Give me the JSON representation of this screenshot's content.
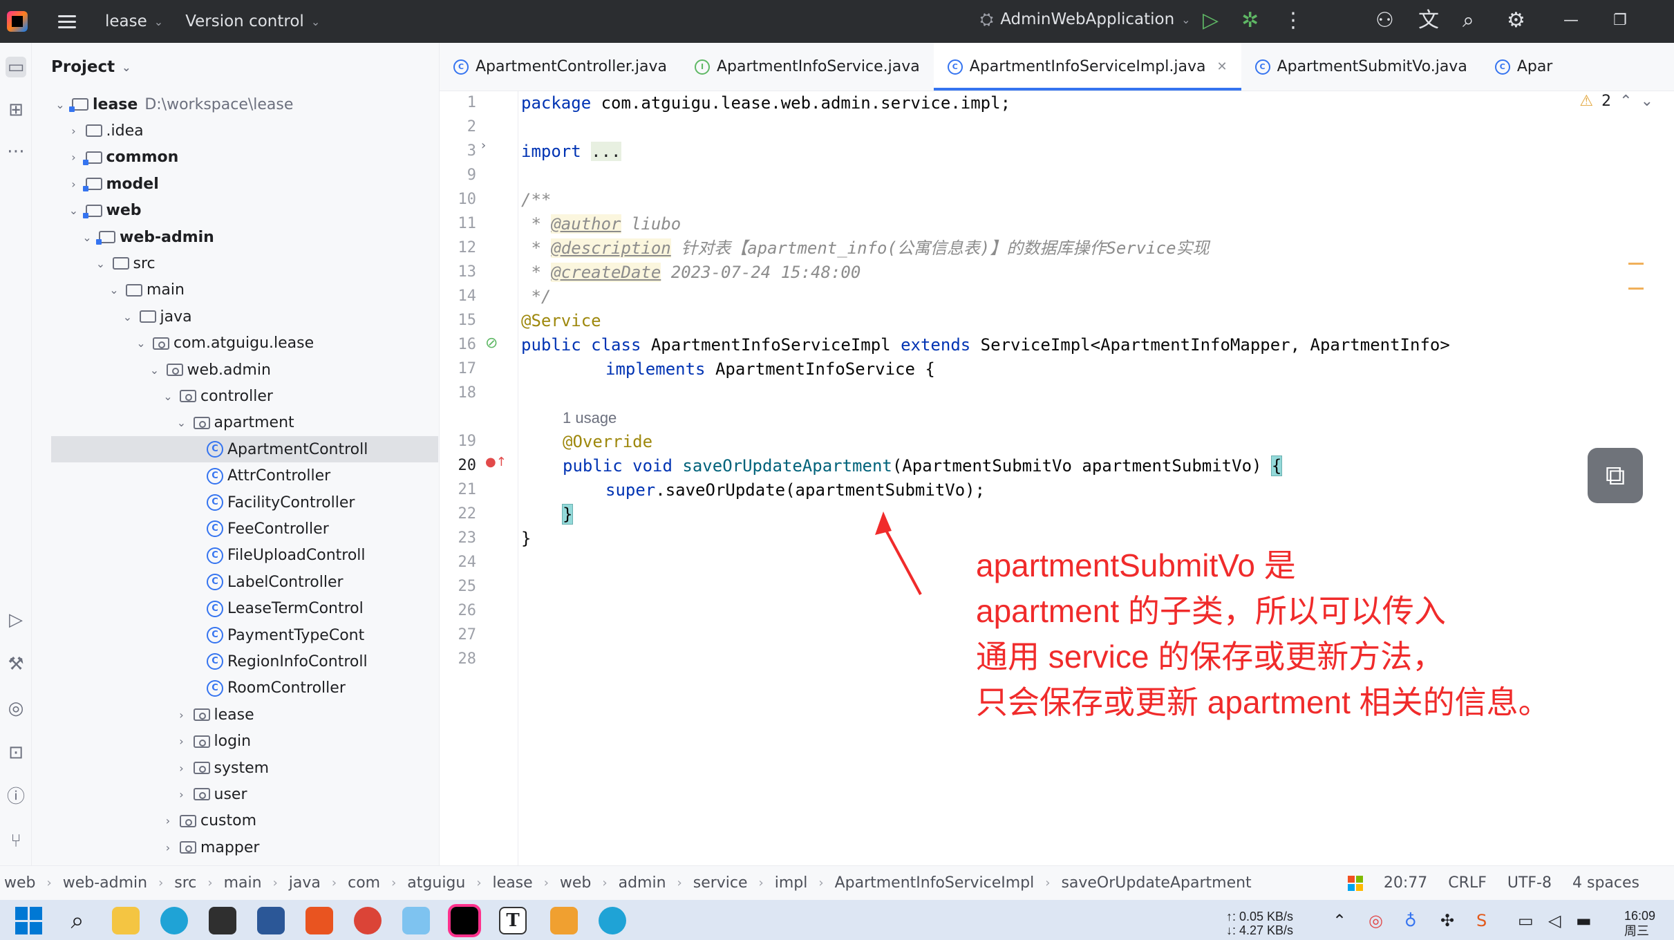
{
  "titlebar": {
    "project": "lease",
    "vcs": "Version control",
    "run_config": "AdminWebApplication"
  },
  "project_panel": {
    "title": "Project",
    "tree": [
      {
        "label": "lease",
        "path": "D:\\workspace\\lease",
        "depth": 0,
        "kind": "module",
        "bold": true,
        "expanded": true
      },
      {
        "label": ".idea",
        "depth": 1,
        "kind": "folder",
        "expanded": false
      },
      {
        "label": "common",
        "depth": 1,
        "kind": "module",
        "bold": true,
        "expanded": false
      },
      {
        "label": "model",
        "depth": 1,
        "kind": "module",
        "bold": true,
        "expanded": false
      },
      {
        "label": "web",
        "depth": 1,
        "kind": "module",
        "bold": true,
        "expanded": true
      },
      {
        "label": "web-admin",
        "depth": 2,
        "kind": "module",
        "bold": true,
        "expanded": true
      },
      {
        "label": "src",
        "depth": 3,
        "kind": "folder",
        "expanded": true
      },
      {
        "label": "main",
        "depth": 4,
        "kind": "folder",
        "expanded": true
      },
      {
        "label": "java",
        "depth": 5,
        "kind": "folder",
        "expanded": true
      },
      {
        "label": "com.atguigu.lease",
        "depth": 6,
        "kind": "package",
        "expanded": true
      },
      {
        "label": "web.admin",
        "depth": 7,
        "kind": "package",
        "expanded": true
      },
      {
        "label": "controller",
        "depth": 8,
        "kind": "package",
        "expanded": true
      },
      {
        "label": "apartment",
        "depth": 9,
        "kind": "package",
        "expanded": true
      },
      {
        "label": "ApartmentControll",
        "depth": 10,
        "kind": "class",
        "selected": true
      },
      {
        "label": "AttrController",
        "depth": 10,
        "kind": "class"
      },
      {
        "label": "FacilityController",
        "depth": 10,
        "kind": "class"
      },
      {
        "label": "FeeController",
        "depth": 10,
        "kind": "class"
      },
      {
        "label": "FileUploadControll",
        "depth": 10,
        "kind": "class"
      },
      {
        "label": "LabelController",
        "depth": 10,
        "kind": "class"
      },
      {
        "label": "LeaseTermControl",
        "depth": 10,
        "kind": "class"
      },
      {
        "label": "PaymentTypeCont",
        "depth": 10,
        "kind": "class"
      },
      {
        "label": "RegionInfoControll",
        "depth": 10,
        "kind": "class"
      },
      {
        "label": "RoomController",
        "depth": 10,
        "kind": "class"
      },
      {
        "label": "lease",
        "depth": 9,
        "kind": "package",
        "expanded": false
      },
      {
        "label": "login",
        "depth": 9,
        "kind": "package",
        "expanded": false
      },
      {
        "label": "system",
        "depth": 9,
        "kind": "package",
        "expanded": false
      },
      {
        "label": "user",
        "depth": 9,
        "kind": "package",
        "expanded": false
      },
      {
        "label": "custom",
        "depth": 8,
        "kind": "package",
        "expanded": false
      },
      {
        "label": "mapper",
        "depth": 8,
        "kind": "package",
        "expanded": false
      }
    ]
  },
  "tabs": [
    {
      "label": "ApartmentController.java",
      "icon": "C",
      "active": false
    },
    {
      "label": "ApartmentInfoService.java",
      "icon": "I",
      "active": false
    },
    {
      "label": "ApartmentInfoServiceImpl.java",
      "icon": "C",
      "active": true
    },
    {
      "label": "ApartmentSubmitVo.java",
      "icon": "C",
      "active": false
    },
    {
      "label": "Apar",
      "icon": "C",
      "active": false
    }
  ],
  "editor": {
    "warnings": "2",
    "usage_hint": "1 usage",
    "line_numbers": [
      "1",
      "2",
      "3",
      "9",
      "10",
      "11",
      "12",
      "13",
      "14",
      "15",
      "16",
      "17",
      "18",
      "19",
      "20",
      "21",
      "22",
      "23",
      "24",
      "25",
      "26",
      "27",
      "28"
    ],
    "code": {
      "l1_kw": "package",
      "l1_rest": " com.atguigu.lease.web.admin.service.impl;",
      "l3_kw": "import",
      "l3_fold": "...",
      "l10": "/**",
      "l11_star": " * ",
      "l11_tag": "@author",
      "l11_text": " liubo",
      "l12_star": " * ",
      "l12_tag": "@description",
      "l12_text": " 针对表【apartment_info(公寓信息表)】的数据库操作Service实现",
      "l13_star": " * ",
      "l13_tag": "@createDate",
      "l13_text": " 2023-07-24 15:48:00",
      "l14": " */",
      "l15": "@Service",
      "l16_kw1": "public class",
      "l16_name": " ApartmentInfoServiceImpl ",
      "l16_kw2": "extends",
      "l16_rest": " ServiceImpl<ApartmentInfoMapper, ApartmentInfo>",
      "l17_kw": "implements",
      "l17_rest": " ApartmentInfoService {",
      "l19": "@Override",
      "l20_kw": "public void",
      "l20_fn": "saveOrUpdateApartment",
      "l20_rest": "(ApartmentSubmitVo apartmentSubmitVo) ",
      "l20_brace": "{",
      "l21_kw": "super",
      "l21_rest": ".saveOrUpdate(apartmentSubmitVo);",
      "l22": "}",
      "l23": "}"
    }
  },
  "annotation": {
    "color": "#f02b2b",
    "lines": [
      "apartmentSubmitVo 是",
      "apartment 的子类，所以可以传入",
      "通用 service 的保存或更新方法，",
      "只会保存或更新 apartment 相关的信息。"
    ]
  },
  "statusbar": {
    "breadcrumb": [
      "web",
      "web-admin",
      "src",
      "main",
      "java",
      "com",
      "atguigu",
      "lease",
      "web",
      "admin",
      "service",
      "impl",
      "ApartmentInfoServiceImpl",
      "saveOrUpdateApartment"
    ],
    "position": "20:77",
    "line_sep": "CRLF",
    "encoding": "UTF-8",
    "indent": "4 spaces"
  },
  "taskbar": {
    "net_up": "↑: 0.05 KB/s",
    "net_down": "↓: 4.27 KB/s",
    "time": "16:09",
    "day": "周三"
  }
}
